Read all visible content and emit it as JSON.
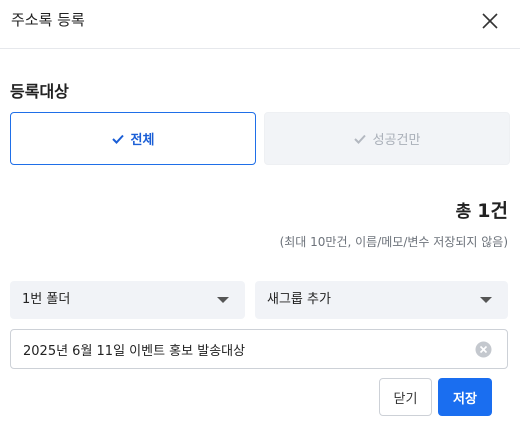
{
  "header": {
    "title": "주소록 등록",
    "close_icon": "close-icon"
  },
  "target": {
    "label": "등록대상",
    "options": [
      {
        "label": "전체",
        "selected": true,
        "icon": "check-icon"
      },
      {
        "label": "성공건만",
        "selected": false,
        "icon": "check-icon"
      }
    ]
  },
  "summary": {
    "total_prefix": "총",
    "total_count": "1건",
    "note": "(최대 10만건, 이름/메모/변수 저장되지 않음)"
  },
  "folder_select": {
    "value": "1번 폴더",
    "icon": "chevron-down-icon"
  },
  "group_select": {
    "value": "새그룹 추가",
    "icon": "chevron-down-icon"
  },
  "name_input": {
    "value": "2025년 6월 11일 이벤트 홍보 발송대상",
    "clear_icon": "clear-icon"
  },
  "actions": {
    "close_label": "닫기",
    "save_label": "저장"
  },
  "colors": {
    "accent": "#1a6ef0",
    "selected_text": "#1a5ed6",
    "muted_bg": "#f2f4f7",
    "muted_text": "#a9afb8"
  }
}
